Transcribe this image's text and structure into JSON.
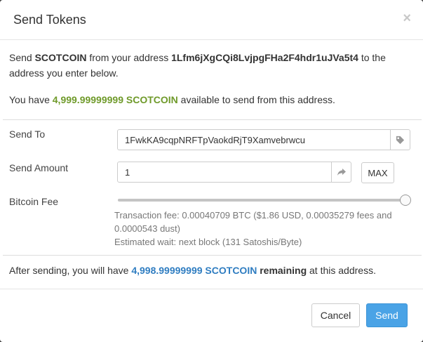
{
  "dialog": {
    "title": "Send Tokens",
    "close_glyph": "×"
  },
  "intro": {
    "part1": "Send ",
    "asset": "SCOTCOIN",
    "part2": " from your address ",
    "address": "1Lfm6jXgCQi8LvjpgFHa2F4hdr1uJVa5t4",
    "part3": " to the",
    "line2": "address you enter below."
  },
  "balance": {
    "prefix": "You have ",
    "amount": "4,999.99999999 SCOTCOIN",
    "suffix": " available to send from this address."
  },
  "form": {
    "send_to": {
      "label": "Send To",
      "value": "1FwkKA9cqpNRFTpVaokdRjT9Xamvebrwcu",
      "addon_icon": "tag-icon"
    },
    "send_amount": {
      "label": "Send Amount",
      "value": "1",
      "addon_icon": "share-icon",
      "max_label": "MAX"
    },
    "fee": {
      "label": "Bitcoin Fee",
      "slider_level_percent": 100,
      "line1": "Transaction fee: 0.00040709 BTC ($1.86 USD, 0.00035279 fees and",
      "line2": "0.0000543 dust)",
      "line3": "Estimated wait: next block (131 Satoshis/Byte)"
    }
  },
  "after": {
    "prefix": "After sending, you will have ",
    "amount": "4,998.99999999 SCOTCOIN",
    "bold": " remaining",
    "suffix": " at this address."
  },
  "footer": {
    "cancel_label": "Cancel",
    "send_label": "Send"
  },
  "colors": {
    "green": "#6f9a2a",
    "blue": "#2f7dc1",
    "primary": "#4aa3e6"
  }
}
